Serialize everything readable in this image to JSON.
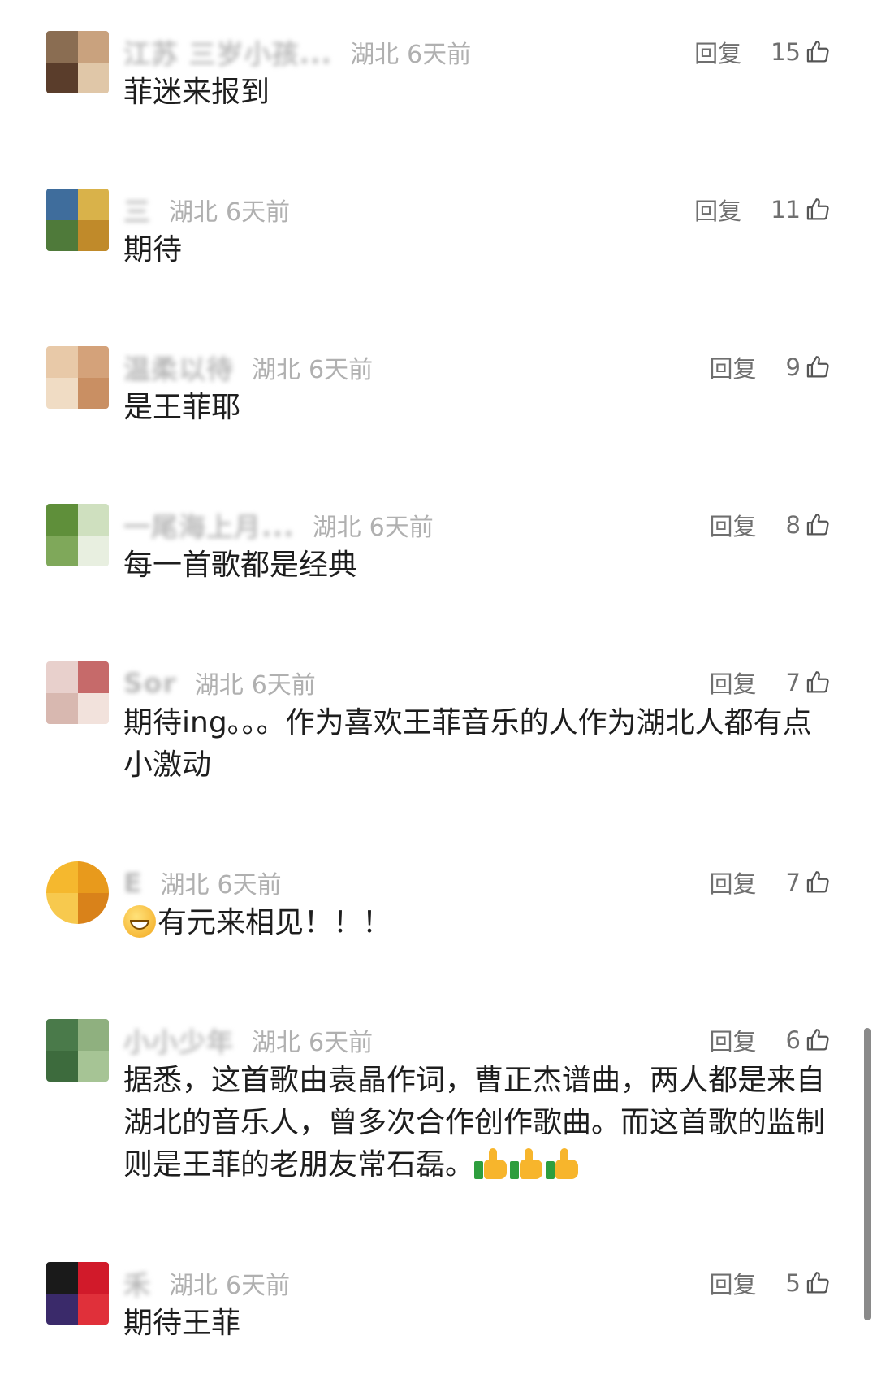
{
  "reply_label": "回复",
  "comments": [
    {
      "username": "江苏 三岁小孩...",
      "location": "湖北",
      "time": "6天前",
      "likes": "15",
      "text": "菲迷来报到",
      "avatar_colors": [
        "#8a6d52",
        "#c9a27e",
        "#5a3d2b",
        "#e0c7a8"
      ]
    },
    {
      "username": "三",
      "location": "湖北",
      "time": "6天前",
      "likes": "11",
      "text": "期待",
      "avatar_colors": [
        "#3f6d9c",
        "#d9b24a",
        "#4f7a3a",
        "#c08a2a"
      ]
    },
    {
      "username": "温柔以待",
      "location": "湖北",
      "time": "6天前",
      "likes": "9",
      "text": "是王菲耶",
      "avatar_colors": [
        "#e8c9a8",
        "#d4a27a",
        "#f0dcc4",
        "#c98f63"
      ]
    },
    {
      "username": "一尾海上月...",
      "location": "湖北",
      "time": "6天前",
      "likes": "8",
      "text": "每一首歌都是经典",
      "avatar_colors": [
        "#5f8f3a",
        "#cfe0bf",
        "#7fa85a",
        "#e8efe0"
      ]
    },
    {
      "username": "Sor",
      "location": "湖北",
      "time": "6天前",
      "likes": "7",
      "text": "期待ing。。。作为喜欢王菲音乐的人作为湖北人都有点小激动",
      "avatar_colors": [
        "#e8d0cc",
        "#c66a6a",
        "#d8b8b0",
        "#f2e2dc"
      ]
    },
    {
      "username": "E",
      "location": "湖北",
      "time": "6天前",
      "likes": "7",
      "text": "有元来相见！！！",
      "emoji": "grin",
      "avatar_colors": [
        "#f5b82e",
        "#e89a1c",
        "#f7c94e",
        "#d9821a"
      ]
    },
    {
      "username": "小小少年",
      "location": "湖北",
      "time": "6天前",
      "likes": "6",
      "text": "据悉，这首歌由袁晶作词，曹正杰谱曲，两人都是来自湖北的音乐人，曾多次合作创作歌曲。而这首歌的监制则是王菲的老朋友常石磊。",
      "emoji": "thumbs",
      "avatar_colors": [
        "#4a7a4a",
        "#8fb07f",
        "#3d6b3d",
        "#a6c495"
      ]
    },
    {
      "username": "禾",
      "location": "湖北",
      "time": "6天前",
      "likes": "5",
      "text": "期待王菲",
      "avatar_colors": [
        "#1a1a1a",
        "#d11a2a",
        "#3a2a6a",
        "#e0303a"
      ]
    }
  ]
}
